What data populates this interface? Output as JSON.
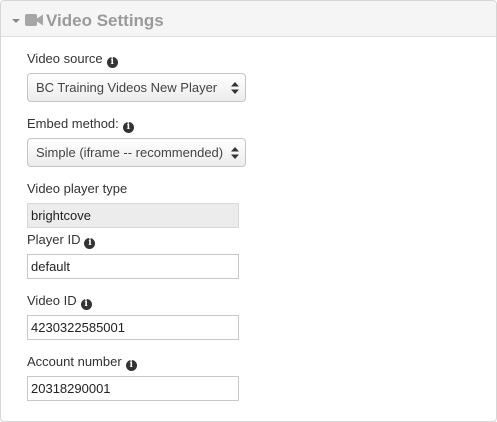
{
  "panel": {
    "title": "Video Settings",
    "header_icon": "video-camera-icon",
    "collapse_icon": "caret-down-icon"
  },
  "fields": {
    "video_source": {
      "label": "Video source",
      "info_icon": "info-circle-icon",
      "selected": "BC Training Videos New Player"
    },
    "embed_method": {
      "label": "Embed method:",
      "info_icon": "info-circle-icon",
      "selected": "Simple (iframe -- recommended)"
    },
    "video_player_type": {
      "label": "Video player type",
      "value": "brightcove"
    },
    "player_id": {
      "label": "Player ID",
      "info_icon": "info-circle-icon",
      "value": "default"
    },
    "video_id": {
      "label": "Video ID",
      "info_icon": "info-circle-icon",
      "value": "4230322585001"
    },
    "account_number": {
      "label": "Account number",
      "info_icon": "info-circle-icon",
      "value": "20318290001"
    }
  },
  "colors": {
    "header_background": "#f5f5f5",
    "title_text": "#9a9a9a",
    "border": "#d6d6d6",
    "readonly_background": "#ececec"
  }
}
